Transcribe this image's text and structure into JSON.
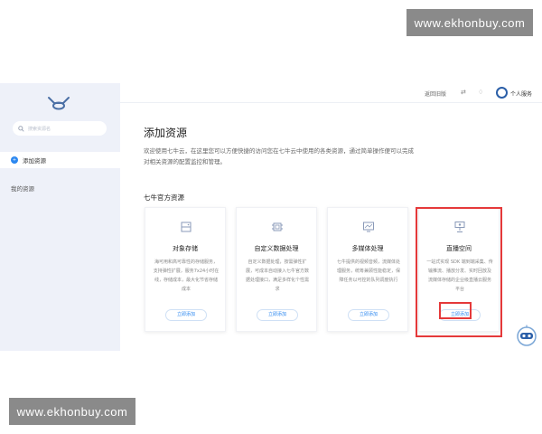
{
  "watermarks": {
    "top": "www.ekhonbuy.com",
    "bottom": "www.ekhonbuy.com"
  },
  "sidebar": {
    "search_placeholder": "搜索资源名",
    "items": [
      {
        "label": "添加资源",
        "active": true
      },
      {
        "label": "我的资源",
        "active": false
      }
    ]
  },
  "topbar": {
    "back_label": "返回旧版",
    "user_label": "个人服务"
  },
  "main": {
    "title": "添加资源",
    "intro": "欢迎使用七牛云，在这里您可以方便快捷的访问您在七牛云中使用的各类资源，通过简单操作便可以完成对相关资源的配置监控和管理。",
    "section_title": "七牛官方资源",
    "cards": [
      {
        "title": "对象存储",
        "desc": "海可用和高可靠性的存储服务，支持弹性扩展，服务7x24小时在线，存储成本，最大化节省存储成本",
        "button": "立即添加"
      },
      {
        "title": "自定义数据处理",
        "desc": "自定义数据处理，按需弹性扩展，可成本自动接入七牛官方数据处理接口，满足多样化个性需求",
        "button": "立即添加"
      },
      {
        "title": "多媒体处理",
        "desc": "七牛提供的视频音频，流媒体处理服务，统筹兼顾性能稳定，保障任务以可控的队列调度执行",
        "button": "立即添加"
      },
      {
        "title": "直播空间",
        "desc": "一站式实现 SDK 端到端采集、传输推流、播放分发、实时回放及流媒体存储的企业级直播云服务平台",
        "button": "立即添加"
      }
    ]
  },
  "colors": {
    "accent": "#2b87f0",
    "highlight": "#e5393a",
    "sidebar_bg": "#eef1f9"
  }
}
